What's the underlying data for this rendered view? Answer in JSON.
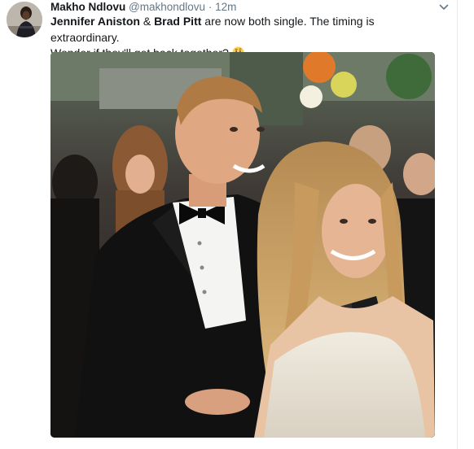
{
  "tweet": {
    "author_name": "Makho Ndlovu",
    "author_handle": "@makhondlovu",
    "separator": "·",
    "timestamp": "12m",
    "text_part1": "Jennifer Aniston",
    "text_part2": " & ",
    "text_part3": "Brad Pitt",
    "text_part4": " are now both single. The timing is extraordinary.",
    "text_part5": "Wonder if they'll get back together?",
    "emoji": "thinking-face"
  },
  "icons": {
    "caret": "chevron-down-icon",
    "avatar": "profile-photo"
  },
  "colors": {
    "name": "#14171a",
    "secondary": "#657786",
    "emoji": "#ffcc4d"
  }
}
